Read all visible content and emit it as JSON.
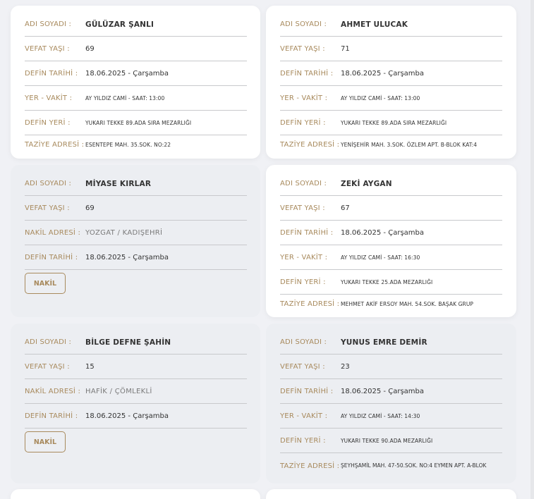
{
  "labels": {
    "name": "ADI SOYADI :",
    "age": "VEFAT YAŞI :",
    "burial_date": "DEFİN TARİHİ :",
    "place_time": "YER - VAKİT :",
    "burial_place": "DEFİN YERİ :",
    "condolence": "TAZİYE ADRESİ :",
    "transfer": "NAKİL ADRESİ :"
  },
  "button_label": "NAKİL",
  "cards": [
    {
      "name": "GÜLÜZAR ŞANLI",
      "age": "69",
      "burial_date": "18.06.2025 - Çarşamba",
      "place_time": "AY YILDIZ CAMİ - SAAT: 13:00",
      "burial_place": "YUKARI TEKKE 89.ADA SIRA MEZARLIĞI",
      "condolence": "ESENTEPE MAH. 35.SOK. NO:22"
    },
    {
      "name": "AHMET ULUCAK",
      "age": "71",
      "burial_date": "18.06.2025 - Çarşamba",
      "place_time": "AY YILDIZ CAMİ - SAAT: 13:00",
      "burial_place": "YUKARI TEKKE 89.ADA SIRA MEZARLIĞI",
      "condolence": "YENİŞEHİR MAH. 3.SOK. ÖZLEM APT. B-BLOK KAT:4"
    },
    {
      "name": "MİYASE KIRLAR",
      "age": "69",
      "transfer": "YOZGAT / KADIŞEHRİ",
      "burial_date": "18.06.2025 - Çarşamba"
    },
    {
      "name": "ZEKİ AYGAN",
      "age": "67",
      "burial_date": "18.06.2025 - Çarşamba",
      "place_time": "AY YILDIZ CAMİ - SAAT: 16:30",
      "burial_place": "YUKARI TEKKE 25.ADA MEZARLIĞI",
      "condolence": "MEHMET AKİF ERSOY MAH. 54.SOK. BAŞAK GRUP"
    },
    {
      "name": "BİLGE DEFNE ŞAHİN",
      "age": "15",
      "transfer": "HAFİK / ÇÖMLEKLİ",
      "burial_date": "18.06.2025 - Çarşamba"
    },
    {
      "name": "YUNUS EMRE DEMİR",
      "age": "23",
      "burial_date": "18.06.2025 - Çarşamba",
      "place_time": "AY YILDIZ CAMİ - SAAT: 14:30",
      "burial_place": "YUKARI TEKKE 90.ADA MEZARLIĞI",
      "condolence": "ŞEYHŞAMİL MAH. 47-50.SOK. NO:4 EYMEN APT. A-BLOK"
    }
  ]
}
